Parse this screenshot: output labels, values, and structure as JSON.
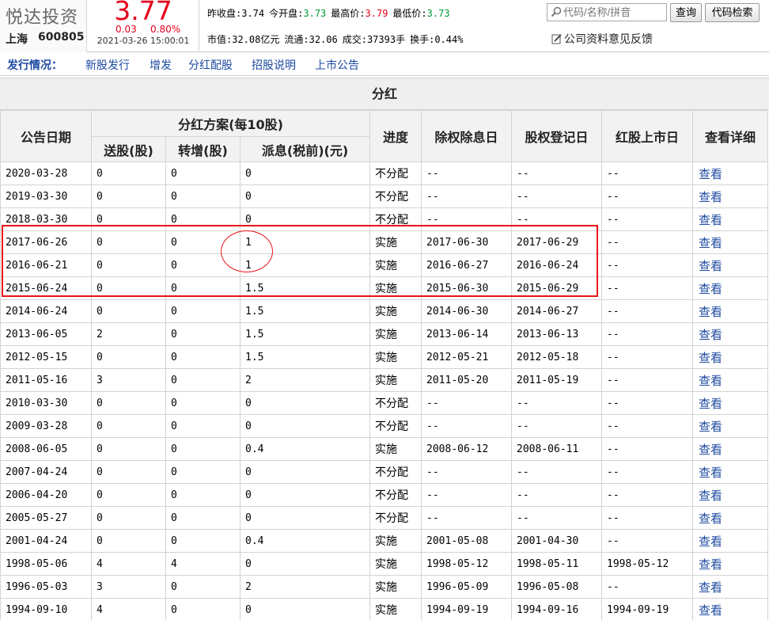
{
  "header": {
    "stock_name": "悦达投资",
    "exchange": "上海",
    "code": "600805",
    "price": "3.77",
    "change": "0.03",
    "change_pct": "0.80%",
    "datetime": "2021-03-26 15:00:01",
    "quote1": {
      "prev_close_label": "昨收盘:",
      "prev_close": "3.74",
      "open_label": "今开盘:",
      "open": "3.73",
      "high_label": "最高价:",
      "high": "3.79",
      "low_label": "最低价:",
      "low": "3.73"
    },
    "quote2": {
      "mktcap_label": "市值:",
      "mktcap": "32.08亿元",
      "float_label": "流通:",
      "float": "32.06",
      "volume_label": "成交:",
      "volume": "37393手",
      "turnover_label": "换手:",
      "turnover": "0.44%"
    },
    "search_placeholder": "代码/名称/拼音",
    "query_button": "查询",
    "code_search_button": "代码检索",
    "feedback_link": "公司资料意见反馈",
    "colors": {
      "up": "#e5001a",
      "down": "#009a2e",
      "link": "#1d4aa1"
    }
  },
  "nav": {
    "title": "发行情况：",
    "links": [
      "新股发行",
      "增发",
      "分红配股",
      "招股说明",
      "上市公告"
    ]
  },
  "section_title": "分红",
  "table": {
    "headers": {
      "date": "公告日期",
      "plan_group": "分红方案(每10股)",
      "bonus": "送股(股)",
      "transfer": "转增(股)",
      "dividend": "派息(税前)(元)",
      "progress": "进度",
      "ex_date": "除权除息日",
      "record_date": "股权登记日",
      "listing_date": "红股上市日",
      "detail": "查看详细"
    },
    "rows": [
      [
        "2020-03-28",
        "0",
        "0",
        "0",
        "不分配",
        "--",
        "--",
        "--",
        "查看"
      ],
      [
        "2019-03-30",
        "0",
        "0",
        "0",
        "不分配",
        "--",
        "--",
        "--",
        "查看"
      ],
      [
        "2018-03-30",
        "0",
        "0",
        "0",
        "不分配",
        "--",
        "--",
        "--",
        "查看"
      ],
      [
        "2017-06-26",
        "0",
        "0",
        "1",
        "实施",
        "2017-06-30",
        "2017-06-29",
        "--",
        "查看"
      ],
      [
        "2016-06-21",
        "0",
        "0",
        "1",
        "实施",
        "2016-06-27",
        "2016-06-24",
        "--",
        "查看"
      ],
      [
        "2015-06-24",
        "0",
        "0",
        "1.5",
        "实施",
        "2015-06-30",
        "2015-06-29",
        "--",
        "查看"
      ],
      [
        "2014-06-24",
        "0",
        "0",
        "1.5",
        "实施",
        "2014-06-30",
        "2014-06-27",
        "--",
        "查看"
      ],
      [
        "2013-06-05",
        "2",
        "0",
        "1.5",
        "实施",
        "2013-06-14",
        "2013-06-13",
        "--",
        "查看"
      ],
      [
        "2012-05-15",
        "0",
        "0",
        "1.5",
        "实施",
        "2012-05-21",
        "2012-05-18",
        "--",
        "查看"
      ],
      [
        "2011-05-16",
        "3",
        "0",
        "2",
        "实施",
        "2011-05-20",
        "2011-05-19",
        "--",
        "查看"
      ],
      [
        "2010-03-30",
        "0",
        "0",
        "0",
        "不分配",
        "--",
        "--",
        "--",
        "查看"
      ],
      [
        "2009-03-28",
        "0",
        "0",
        "0",
        "不分配",
        "--",
        "--",
        "--",
        "查看"
      ],
      [
        "2008-06-05",
        "0",
        "0",
        "0.4",
        "实施",
        "2008-06-12",
        "2008-06-11",
        "--",
        "查看"
      ],
      [
        "2007-04-24",
        "0",
        "0",
        "0",
        "不分配",
        "--",
        "--",
        "--",
        "查看"
      ],
      [
        "2006-04-20",
        "0",
        "0",
        "0",
        "不分配",
        "--",
        "--",
        "--",
        "查看"
      ],
      [
        "2005-05-27",
        "0",
        "0",
        "0",
        "不分配",
        "--",
        "--",
        "--",
        "查看"
      ],
      [
        "2001-04-24",
        "0",
        "0",
        "0.4",
        "实施",
        "2001-05-08",
        "2001-04-30",
        "--",
        "查看"
      ],
      [
        "1998-05-06",
        "4",
        "4",
        "0",
        "实施",
        "1998-05-12",
        "1998-05-11",
        "1998-05-12",
        "查看"
      ],
      [
        "1996-05-03",
        "3",
        "0",
        "2",
        "实施",
        "1996-05-09",
        "1996-05-08",
        "--",
        "查看"
      ],
      [
        "1994-09-10",
        "4",
        "0",
        "0",
        "实施",
        "1994-09-19",
        "1994-09-16",
        "1994-09-19",
        "查看"
      ]
    ]
  }
}
